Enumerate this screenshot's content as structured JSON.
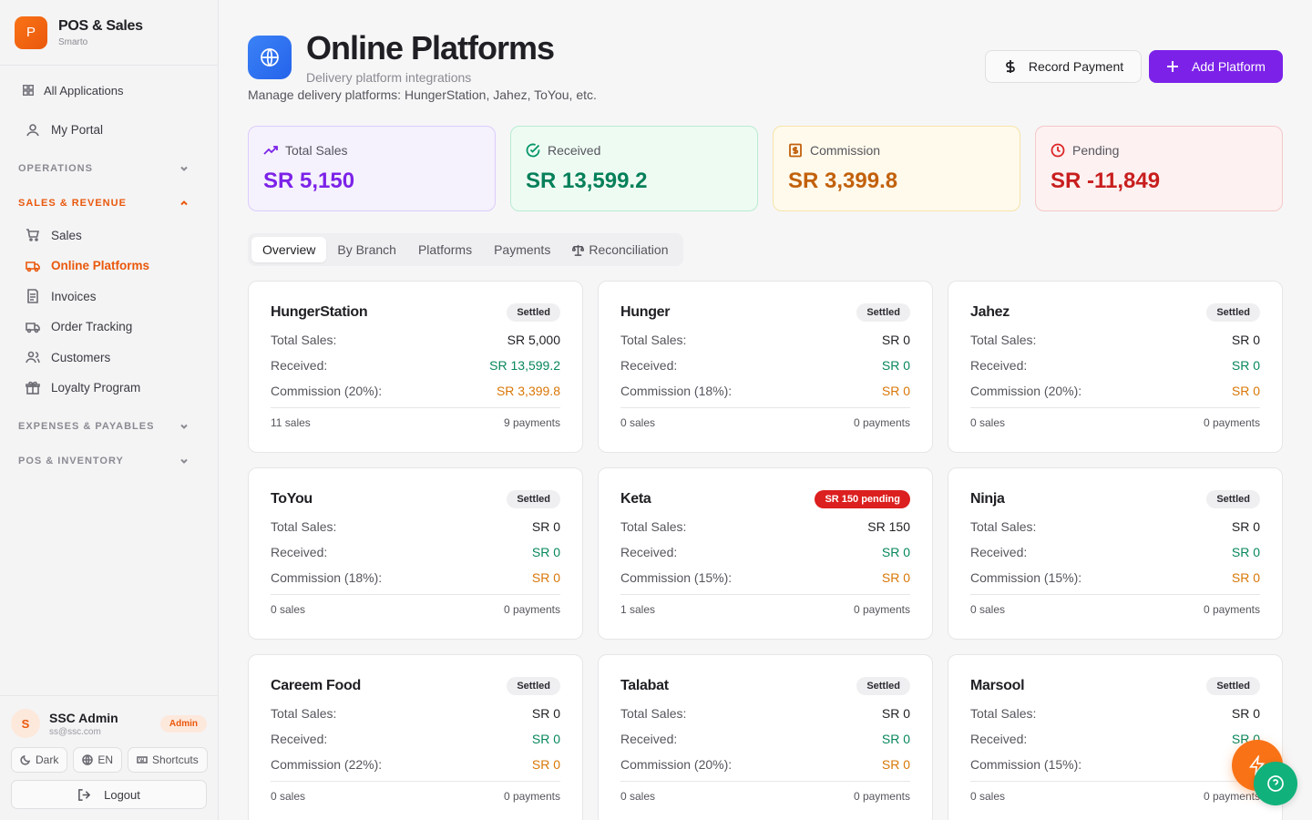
{
  "sidebar": {
    "brand": {
      "logo_letter": "P",
      "title": "POS & Sales",
      "subtitle": "Smarto"
    },
    "all_apps": "All Applications",
    "my_portal": "My Portal",
    "sections": {
      "operations": "OPERATIONS",
      "sales_revenue": "SALES & REVENUE",
      "expenses": "EXPENSES & PAYABLES",
      "pos_inventory": "POS & INVENTORY"
    },
    "sales_items": [
      {
        "label": "Sales",
        "icon": "cart-icon"
      },
      {
        "label": "Online Platforms",
        "icon": "truck-icon",
        "active": true
      },
      {
        "label": "Invoices",
        "icon": "invoice-icon"
      },
      {
        "label": "Order Tracking",
        "icon": "truck-icon"
      },
      {
        "label": "Customers",
        "icon": "users-icon"
      },
      {
        "label": "Loyalty Program",
        "icon": "gift-icon"
      }
    ],
    "user": {
      "initial": "S",
      "name": "SSC Admin",
      "email": "ss@ssc.com",
      "role": "Admin"
    },
    "theme": "Dark",
    "language": "EN",
    "shortcuts": "Shortcuts",
    "logout": "Logout"
  },
  "header": {
    "title": "Online Platforms",
    "subtitle": "Delivery platform integrations",
    "description": "Manage delivery platforms: HungerStation, Jahez, ToYou, etc.",
    "record_payment": "Record Payment",
    "add_platform": "Add Platform"
  },
  "stats": [
    {
      "label": "Total Sales",
      "value": "SR 5,150",
      "color": "#7c22e8"
    },
    {
      "label": "Received",
      "value": "SR 13,599.2",
      "color": "#07805a"
    },
    {
      "label": "Commission",
      "value": "SR 3,399.8",
      "color": "#c2610c"
    },
    {
      "label": "Pending",
      "value": "SR -11,849",
      "color": "#c81e1e"
    }
  ],
  "tabs": [
    "Overview",
    "By Branch",
    "Platforms",
    "Payments",
    "Reconciliation"
  ],
  "labels": {
    "total_sales": "Total Sales:",
    "received": "Received:"
  },
  "platforms": [
    {
      "name": "HungerStation",
      "status": "Settled",
      "total": "SR 5,000",
      "received": "SR 13,599.2",
      "commission_label": "Commission (20%):",
      "commission": "SR 3,399.8",
      "sales": "11 sales",
      "payments": "9 payments"
    },
    {
      "name": "Hunger",
      "status": "Settled",
      "total": "SR 0",
      "received": "SR 0",
      "commission_label": "Commission (18%):",
      "commission": "SR 0",
      "sales": "0 sales",
      "payments": "0 payments"
    },
    {
      "name": "Jahez",
      "status": "Settled",
      "total": "SR 0",
      "received": "SR 0",
      "commission_label": "Commission (20%):",
      "commission": "SR 0",
      "sales": "0 sales",
      "payments": "0 payments"
    },
    {
      "name": "ToYou",
      "status": "Settled",
      "total": "SR 0",
      "received": "SR 0",
      "commission_label": "Commission (18%):",
      "commission": "SR 0",
      "sales": "0 sales",
      "payments": "0 payments"
    },
    {
      "name": "Keta",
      "status": "SR 150 pending",
      "total": "SR 150",
      "received": "SR 0",
      "commission_label": "Commission (15%):",
      "commission": "SR 0",
      "sales": "1 sales",
      "payments": "0 payments"
    },
    {
      "name": "Ninja",
      "status": "Settled",
      "total": "SR 0",
      "received": "SR 0",
      "commission_label": "Commission (15%):",
      "commission": "SR 0",
      "sales": "0 sales",
      "payments": "0 payments"
    },
    {
      "name": "Careem Food",
      "status": "Settled",
      "total": "SR 0",
      "received": "SR 0",
      "commission_label": "Commission (22%):",
      "commission": "SR 0",
      "sales": "0 sales",
      "payments": "0 payments"
    },
    {
      "name": "Talabat",
      "status": "Settled",
      "total": "SR 0",
      "received": "SR 0",
      "commission_label": "Commission (20%):",
      "commission": "SR 0",
      "sales": "0 sales",
      "payments": "0 payments"
    },
    {
      "name": "Marsool",
      "status": "Settled",
      "total": "SR 0",
      "received": "SR 0",
      "commission_label": "Commission (15%):",
      "commission": "SR 0",
      "sales": "0 sales",
      "payments": "0 payments"
    }
  ]
}
